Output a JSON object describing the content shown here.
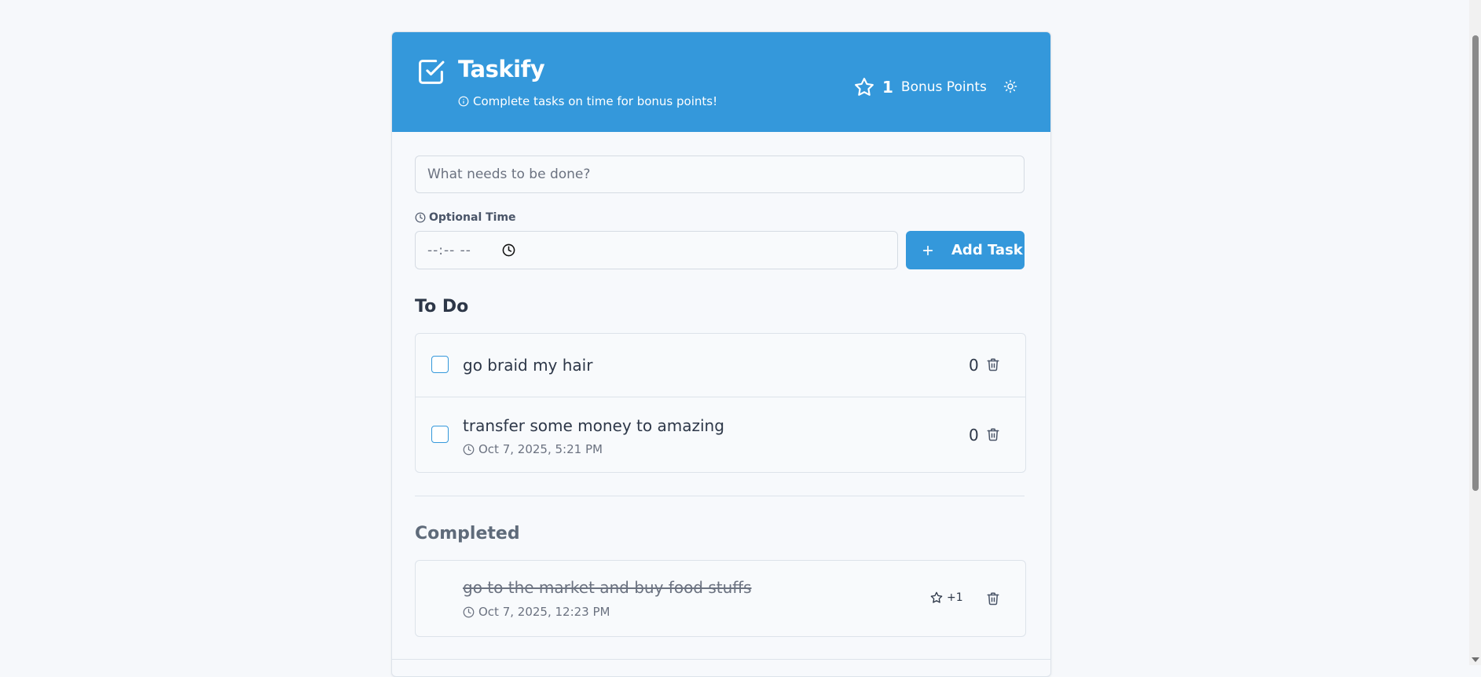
{
  "header": {
    "title": "Taskify",
    "subtitle": "Complete tasks on time for bonus points!",
    "bonus_count": "1",
    "bonus_label": "Bonus Points"
  },
  "form": {
    "task_placeholder": "What needs to be done?",
    "task_value": "",
    "time_label": "Optional Time",
    "time_value": "--:-- --",
    "add_button": "Add Task"
  },
  "todo": {
    "title": "To Do",
    "items": [
      {
        "text": "go braid my hair",
        "points": "0"
      },
      {
        "text": "transfer some money to amazing",
        "time": "Oct 7, 2025, 5:21 PM",
        "points": "0"
      }
    ]
  },
  "completed": {
    "title": "Completed",
    "items": [
      {
        "text": "go to the market and buy food stuffs",
        "time": "Oct 7, 2025, 12:23 PM",
        "bonus": "+1"
      }
    ]
  },
  "colors": {
    "accent": "#3498db",
    "background": "#f6f8fb"
  },
  "icons": [
    "check-square-icon",
    "info-icon",
    "star-icon",
    "sun-icon",
    "clock-icon",
    "plus-icon",
    "trash-icon"
  ]
}
